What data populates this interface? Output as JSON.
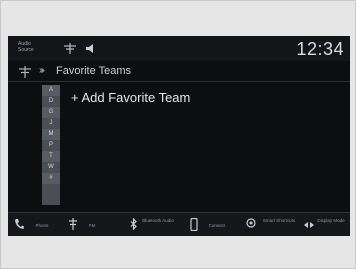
{
  "status_bar": {
    "audio_source_label": "Audio Source",
    "clock": "12:34"
  },
  "header": {
    "title": "Favorite Teams"
  },
  "alpha_index": [
    "A",
    "D",
    "G",
    "J",
    "M",
    "P",
    "T",
    "W",
    "#"
  ],
  "content": {
    "add_favorite_label": "+ Add Favorite Team"
  },
  "dock": {
    "items": [
      {
        "label": "Phone",
        "icon": "phone-icon"
      },
      {
        "label": "FM",
        "icon": "radio-icon"
      },
      {
        "label": "Bluetooth Audio",
        "icon": "bluetooth-icon"
      },
      {
        "label": "Connect",
        "icon": "smartphone-icon"
      },
      {
        "label": "Smart Shortcuts",
        "icon": "shortcuts-icon"
      },
      {
        "label": "Display Mode",
        "icon": "display-mode-icon"
      }
    ]
  },
  "colors": {
    "screen_bg": "#0d0e10",
    "text_primary": "#e3e7ea",
    "alpha_bar_bg": "#4b4f55"
  }
}
